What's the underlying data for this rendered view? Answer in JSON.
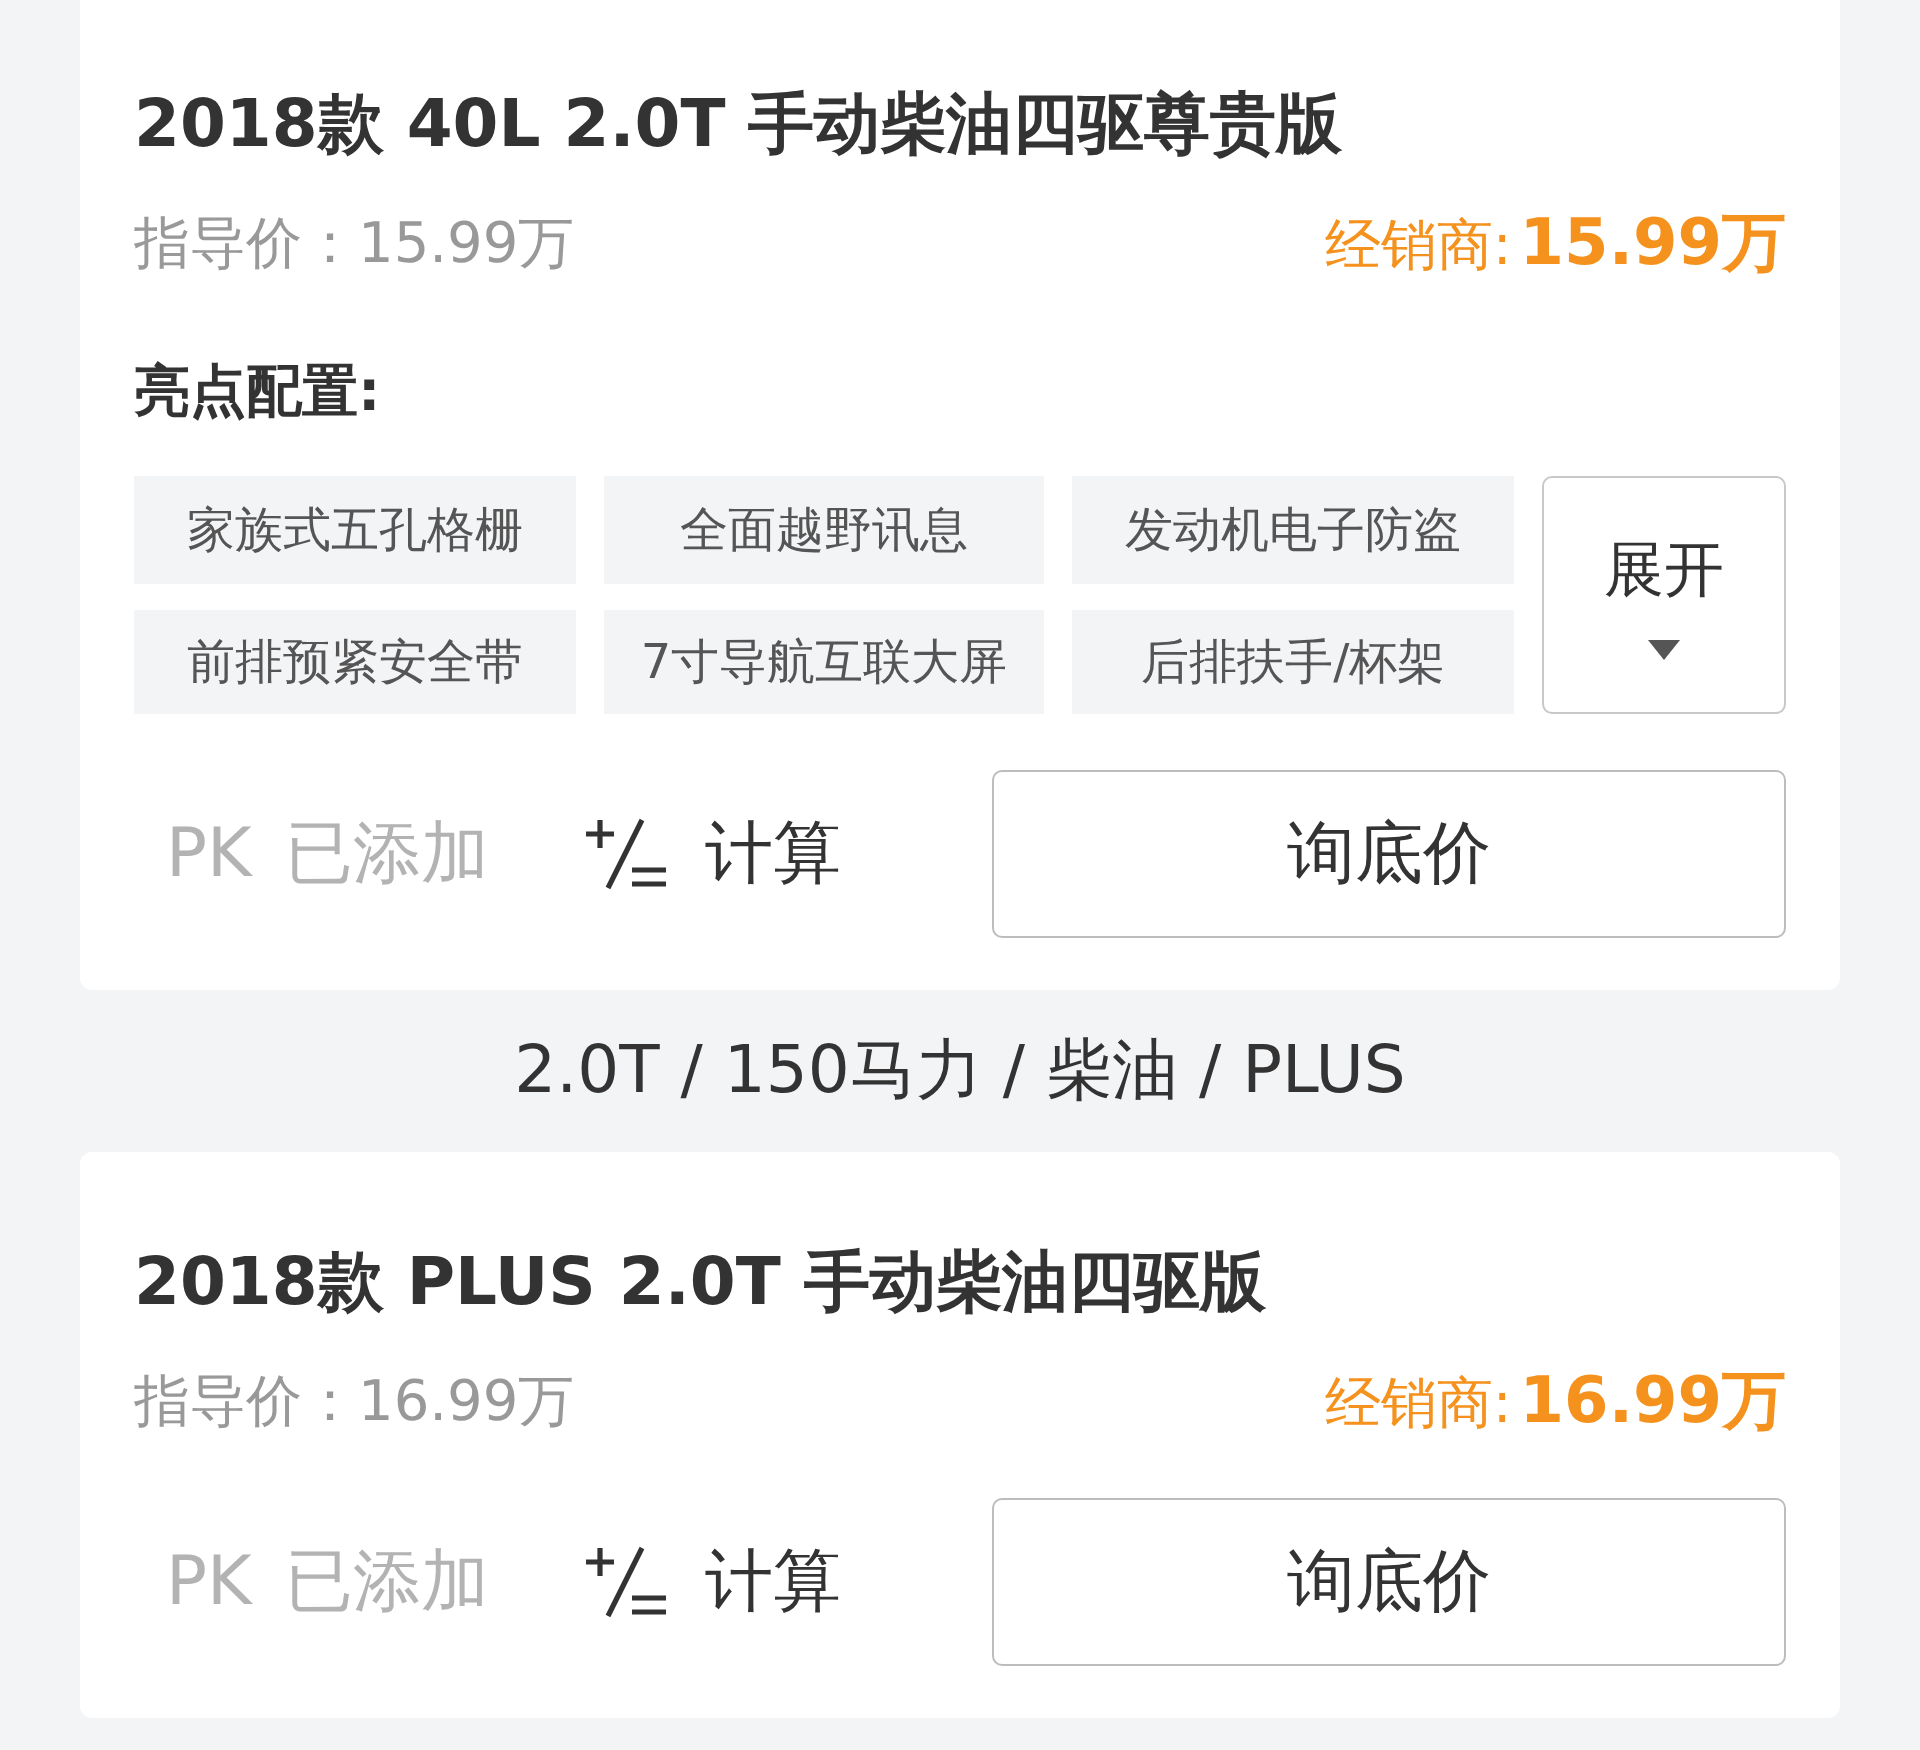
{
  "trim_list": [
    {
      "kind": "trim",
      "title": "2018款 40L 2.0T 手动柴油四驱尊贵版",
      "guide_price": "指导价：15.99万",
      "dealer_label": "经销商:",
      "dealer_price": "15.99万",
      "highlights": {
        "heading": "亮点配置:",
        "tags": [
          "家族式五孔格栅",
          "全面越野讯息",
          "发动机电子防盗",
          "前排预紧安全带",
          "7寸导航互联大屏",
          "后排扶手/杯架"
        ],
        "expand_button": "展开"
      },
      "pk_button": {
        "label": "PK 已添加",
        "disabled": true
      },
      "calc_button": "计算",
      "inquire_button": "询底价"
    },
    {
      "kind": "group_header",
      "text": "2.0T / 150马力 / 柴油 / PLUS"
    },
    {
      "kind": "trim",
      "title": "2018款 PLUS 2.0T 手动柴油四驱版",
      "guide_price": "指导价：16.99万",
      "dealer_label": "经销商:",
      "dealer_price": "16.99万",
      "pk_button": {
        "label": "PK 已添加",
        "disabled": true
      },
      "calc_button": "计算",
      "inquire_button": "询底价"
    }
  ]
}
